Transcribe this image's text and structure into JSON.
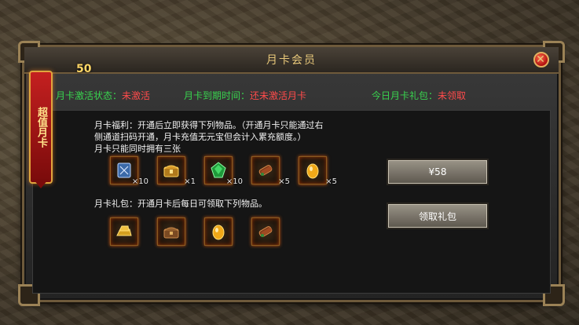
{
  "window": {
    "title": "月卡会员",
    "close_glyph": "✕"
  },
  "status": {
    "activation_label": "月卡激活状态：",
    "activation_value": "未激活",
    "expiry_label": "月卡到期时间：",
    "expiry_value": "还未激活月卡",
    "gift_label": "今日月卡礼包：",
    "gift_value": "未领取"
  },
  "ribbon": {
    "text": "超值月卡",
    "badge": "50"
  },
  "benefits": {
    "line1": "月卡福利：开通后立即获得下列物品。（开通月卡只能通过右",
    "line2": "侧通道扫码开通，月卡充值无元宝但会计入累充额度。）",
    "line3": "月卡只能同时拥有三张",
    "items": [
      {
        "icon": "spellbook-icon",
        "qty": "×10"
      },
      {
        "icon": "treasure-chest-icon",
        "qty": "×1"
      },
      {
        "icon": "green-gem-icon",
        "qty": "×10"
      },
      {
        "icon": "scroll-bundle-icon",
        "qty": "×5"
      },
      {
        "icon": "golden-egg-icon",
        "qty": "×5"
      }
    ]
  },
  "daily_gift": {
    "text": "月卡礼包：开通月卡后每日可领取下列物品。",
    "items": [
      {
        "icon": "gold-bar-icon"
      },
      {
        "icon": "wood-chest-icon"
      },
      {
        "icon": "golden-egg-icon"
      },
      {
        "icon": "scroll-bundle-icon"
      }
    ]
  },
  "buttons": {
    "price_label": "¥58",
    "claim_label": "领取礼包"
  },
  "colors": {
    "accent_green": "#39d44f",
    "accent_red": "#ff4b4b",
    "title_gold": "#e8c87a"
  }
}
